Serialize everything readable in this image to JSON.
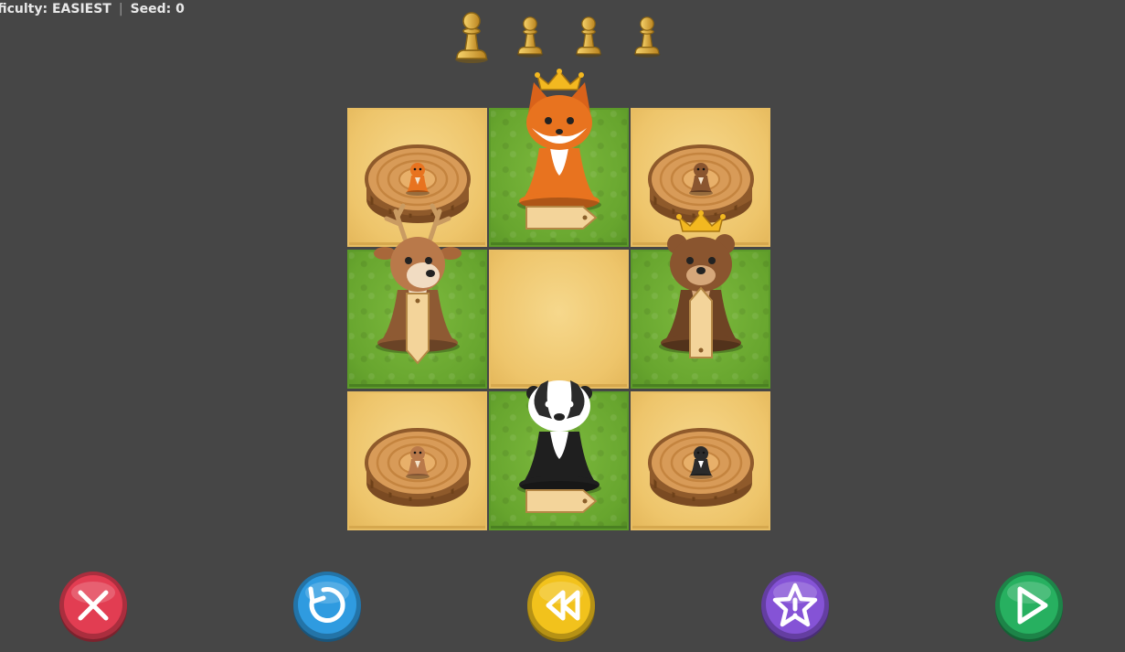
{
  "status": {
    "difficulty_text": "fficulty: EASIEST",
    "seed_text": "Seed: 0"
  },
  "progress": {
    "total_levels": 4,
    "current_level": 1,
    "pawn_icon": "pawn-icon"
  },
  "board": {
    "rows": 3,
    "cols": 3,
    "tiles": [
      [
        "sand",
        "grass",
        "sand"
      ],
      [
        "grass",
        "sand",
        "grass"
      ],
      [
        "sand",
        "grass",
        "sand"
      ]
    ],
    "targets": [
      {
        "row": 0,
        "col": 0,
        "animal": "fox"
      },
      {
        "row": 0,
        "col": 2,
        "animal": "bear"
      },
      {
        "row": 2,
        "col": 0,
        "animal": "deer"
      },
      {
        "row": 2,
        "col": 2,
        "animal": "badger"
      }
    ],
    "pieces": [
      {
        "animal": "fox",
        "row": 0,
        "col": 1,
        "crowned": true,
        "arrow": "right"
      },
      {
        "animal": "deer",
        "row": 1,
        "col": 0,
        "crowned": false,
        "arrow": "down"
      },
      {
        "animal": "bear",
        "row": 1,
        "col": 2,
        "crowned": true,
        "arrow": "up"
      },
      {
        "animal": "badger",
        "row": 2,
        "col": 1,
        "crowned": false,
        "arrow": "right"
      }
    ]
  },
  "controls": {
    "buttons": [
      {
        "name": "close-button",
        "icon": "close-icon",
        "color": "#e23d52"
      },
      {
        "name": "restart-button",
        "icon": "restart-icon",
        "color": "#2f9be0"
      },
      {
        "name": "rewind-button",
        "icon": "rewind-icon",
        "color": "#f2c21c"
      },
      {
        "name": "hint-button",
        "icon": "star-hint-icon",
        "color": "#8553d6"
      },
      {
        "name": "play-button",
        "icon": "play-icon",
        "color": "#27b060"
      }
    ]
  },
  "colors": {
    "background": "#464646",
    "sand": "#eec56b",
    "grass": "#67a52e",
    "fox": "#e8731f",
    "deer": "#b9794a",
    "bear": "#8a552f",
    "badger": "#2b2b2b",
    "crown": "#f3b820",
    "pawn": "#d6a437"
  }
}
